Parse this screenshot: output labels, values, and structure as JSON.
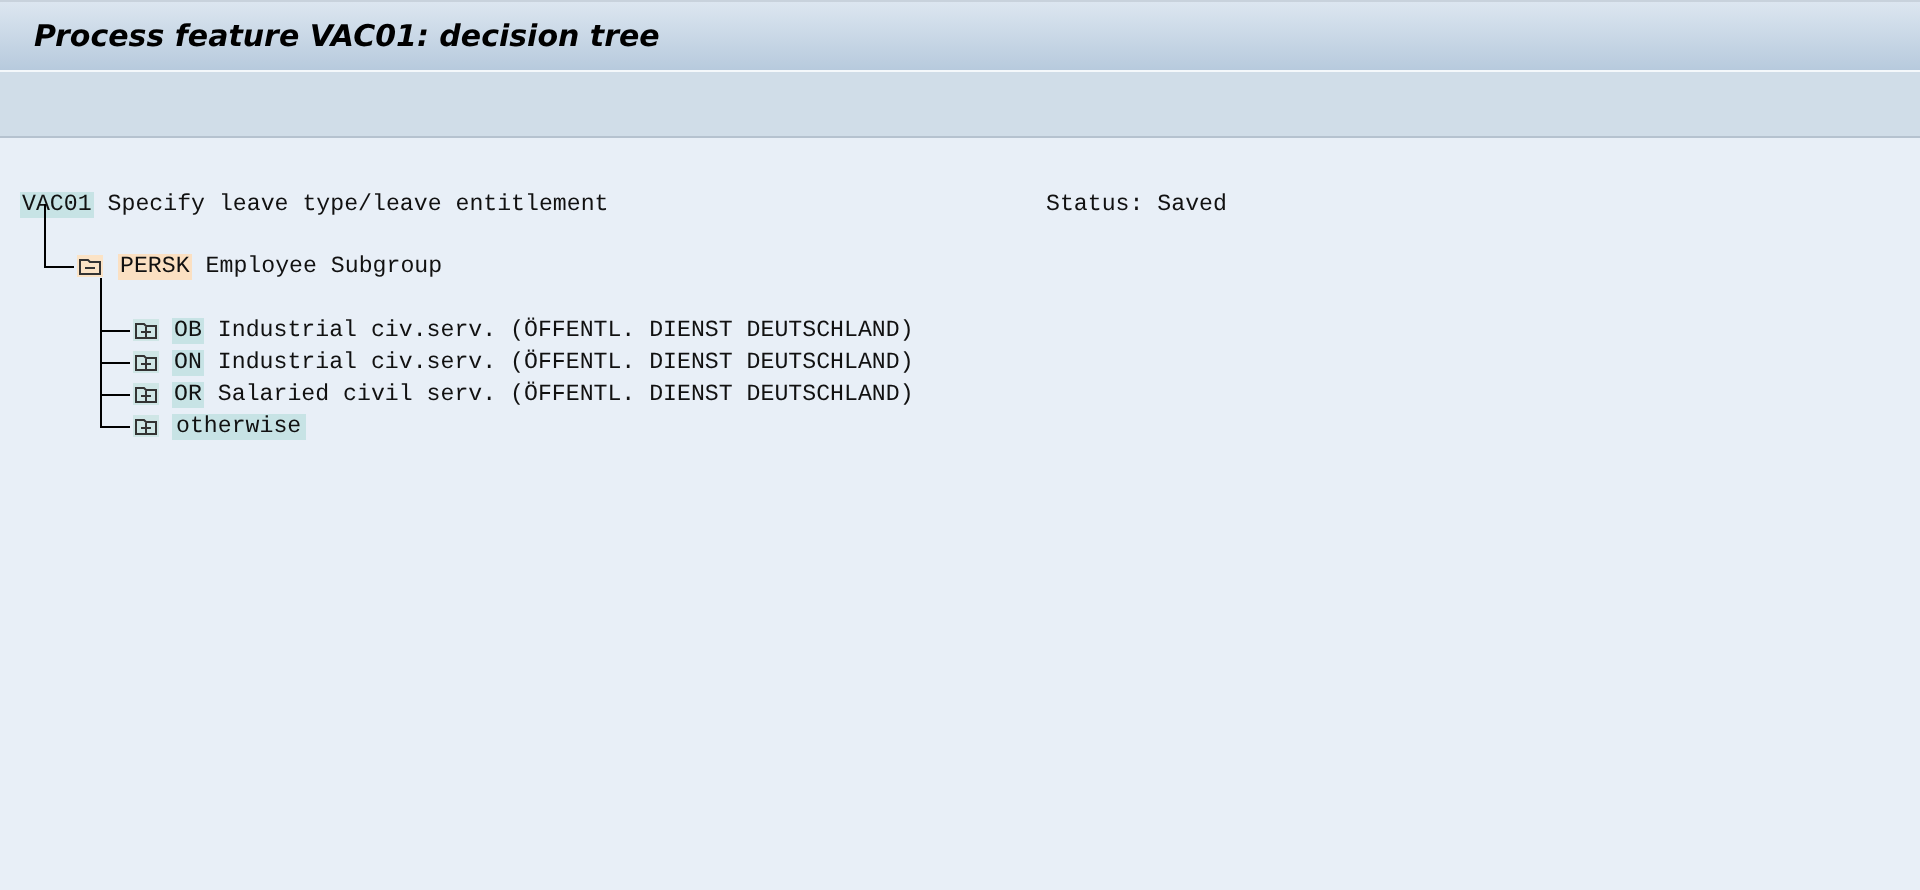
{
  "window": {
    "title": "Process feature VAC01: decision tree"
  },
  "tree": {
    "code": "VAC01",
    "text": "Specify leave type/leave entitlement",
    "status": "Status: Saved",
    "children": [
      {
        "kind": "field",
        "code": "PERSK",
        "text": "Employee Subgroup",
        "expanded": true,
        "children": [
          {
            "kind": "value",
            "code": "OB",
            "text": "Industrial civ.serv. (ÖFFENTL. DIENST DEUTSCHLAND)",
            "expanded": false
          },
          {
            "kind": "value",
            "code": "ON",
            "text": "Industrial civ.serv. (ÖFFENTL. DIENST DEUTSCHLAND)",
            "expanded": false
          },
          {
            "kind": "value",
            "code": "OR",
            "text": "Salaried civil serv. (ÖFFENTL. DIENST DEUTSCHLAND)",
            "expanded": false
          },
          {
            "kind": "otherwise",
            "text": "otherwise",
            "expanded": false
          }
        ]
      }
    ]
  }
}
